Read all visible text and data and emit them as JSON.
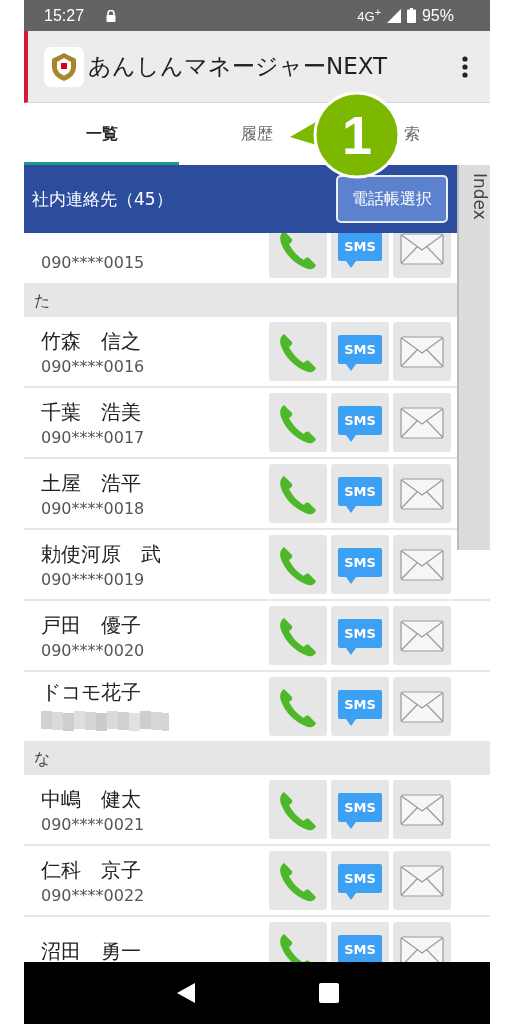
{
  "status_bar": {
    "time": "15:27",
    "network": "4G$^{+}$",
    "battery": "95%"
  },
  "app_bar": {
    "title": "あんしんマネージャーNEXT"
  },
  "tabs": [
    {
      "label": "一覧",
      "selected": true
    },
    {
      "label": "履歴",
      "selected": false
    },
    {
      "label": "索",
      "selected": false
    }
  ],
  "header": {
    "title": "社内連絡先（45）",
    "button": "電話帳選択"
  },
  "index_tab": {
    "label": "Index"
  },
  "list": [
    {
      "kind": "contact",
      "phone": "090****0015",
      "phone_hidden": false,
      "sms": "SMS"
    },
    {
      "kind": "section",
      "label": "た"
    },
    {
      "kind": "contact",
      "name": "竹森　信之",
      "phone": "090****0016",
      "phone_hidden": false,
      "sms": "SMS"
    },
    {
      "kind": "contact",
      "name": "千葉　浩美",
      "phone": "090****0017",
      "phone_hidden": false,
      "sms": "SMS"
    },
    {
      "kind": "contact",
      "name": "土屋　浩平",
      "phone": "090****0018",
      "phone_hidden": false,
      "sms": "SMS"
    },
    {
      "kind": "contact",
      "name": "勅使河原　武",
      "phone": "090****0019",
      "phone_hidden": false,
      "sms": "SMS"
    },
    {
      "kind": "contact",
      "name": "戸田　優子",
      "phone": "090****0020",
      "phone_hidden": false,
      "sms": "SMS"
    },
    {
      "kind": "contact",
      "name": "ドコモ花子",
      "phone_hidden": true,
      "sms": "SMS"
    },
    {
      "kind": "section",
      "label": "な"
    },
    {
      "kind": "contact",
      "name": "中嶋　健太",
      "phone": "090****0021",
      "phone_hidden": false,
      "sms": "SMS"
    },
    {
      "kind": "contact",
      "name": "仁科　京子",
      "phone": "090****0022",
      "phone_hidden": false,
      "sms": "SMS"
    },
    {
      "kind": "contact",
      "name": "沼田　勇一",
      "phone_hidden": false,
      "sms": "SMS"
    }
  ],
  "callout": {
    "number": "1"
  }
}
